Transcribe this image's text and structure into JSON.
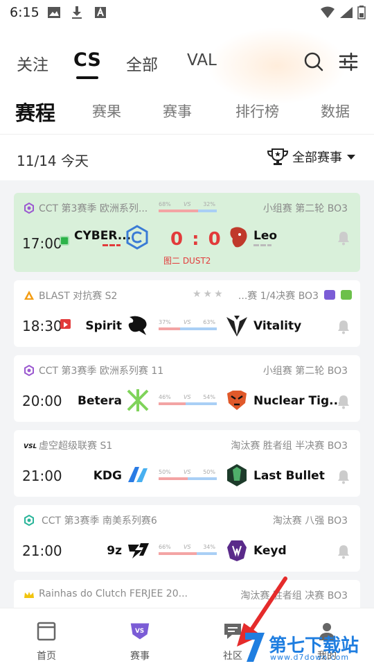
{
  "status_bar": {
    "time": "6:15"
  },
  "game_tabs": [
    {
      "label": "关注",
      "active": false
    },
    {
      "label": "CS",
      "active": true
    },
    {
      "label": "全部",
      "active": false
    },
    {
      "label": "VAL",
      "active": false
    }
  ],
  "sub_tabs": [
    {
      "label": "赛程",
      "active": true
    },
    {
      "label": "赛果",
      "active": false
    },
    {
      "label": "赛事",
      "active": false
    },
    {
      "label": "排行榜",
      "active": false
    },
    {
      "label": "数据",
      "active": false
    }
  ],
  "date_header": "11/14 今天",
  "filter_label": "全部赛事",
  "matches": [
    {
      "tournament": "CCT 第3赛季 欧洲系列...",
      "stage": "小组赛 第二轮 BO3",
      "time": "17:00",
      "team1": "CYBER...",
      "team2": "Leo",
      "score": "0 : 0",
      "map_info": "图二 DUST2",
      "pct1": "68%",
      "pct2": "32%",
      "vs": "VS",
      "pct1_value": 68,
      "live": true
    },
    {
      "tournament": "BLAST 对抗赛 S2",
      "stage": "...赛 1/4决赛  BO3",
      "time": "18:30",
      "team1": "Spirit",
      "team2": "Vitality",
      "pct1": "37%",
      "pct2": "63%",
      "vs": "VS",
      "pct1_value": 37,
      "live": false
    },
    {
      "tournament": "CCT 第3赛季 欧洲系列赛 11",
      "stage": "小组赛 第二轮 BO3",
      "time": "20:00",
      "team1": "Betera",
      "team2": "Nuclear Tig...",
      "pct1": "46%",
      "pct2": "54%",
      "vs": "VS",
      "pct1_value": 46,
      "live": false
    },
    {
      "tournament": "虚空超级联赛 S1",
      "stage": "淘汰赛 胜者组 半决赛 BO3",
      "time": "21:00",
      "team1": "KDG",
      "team2": "Last Bullet",
      "pct1": "50%",
      "pct2": "50%",
      "vs": "VS",
      "pct1_value": 50,
      "live": false
    },
    {
      "tournament": "CCT 第3赛季 南美系列赛6",
      "stage": "淘汰赛 八强 BO3",
      "time": "21:00",
      "team1": "9z",
      "team2": "Keyd",
      "pct1": "66%",
      "pct2": "34%",
      "vs": "VS",
      "pct1_value": 66,
      "live": false
    },
    {
      "tournament": "Rainhas do Clutch FERJEE 20...",
      "stage": "淘汰赛 胜者组 决赛 BO3",
      "live": false
    }
  ],
  "bottom_nav": [
    {
      "label": "首页",
      "icon": "home-icon"
    },
    {
      "label": "赛事",
      "icon": "vs-shield-icon"
    },
    {
      "label": "社区",
      "icon": "chat-icon"
    },
    {
      "label": "我的",
      "icon": "user-icon"
    }
  ],
  "watermark": {
    "text": "第七下载站",
    "url": "www.d7down.com"
  },
  "colors": {
    "accent": "#111111",
    "live_bg": "#d9f0da",
    "score": "#e23b3b",
    "bar_left": "#f3a4a4",
    "bar_right": "#a9cff5",
    "vs_icon": "#7b5cd6"
  }
}
